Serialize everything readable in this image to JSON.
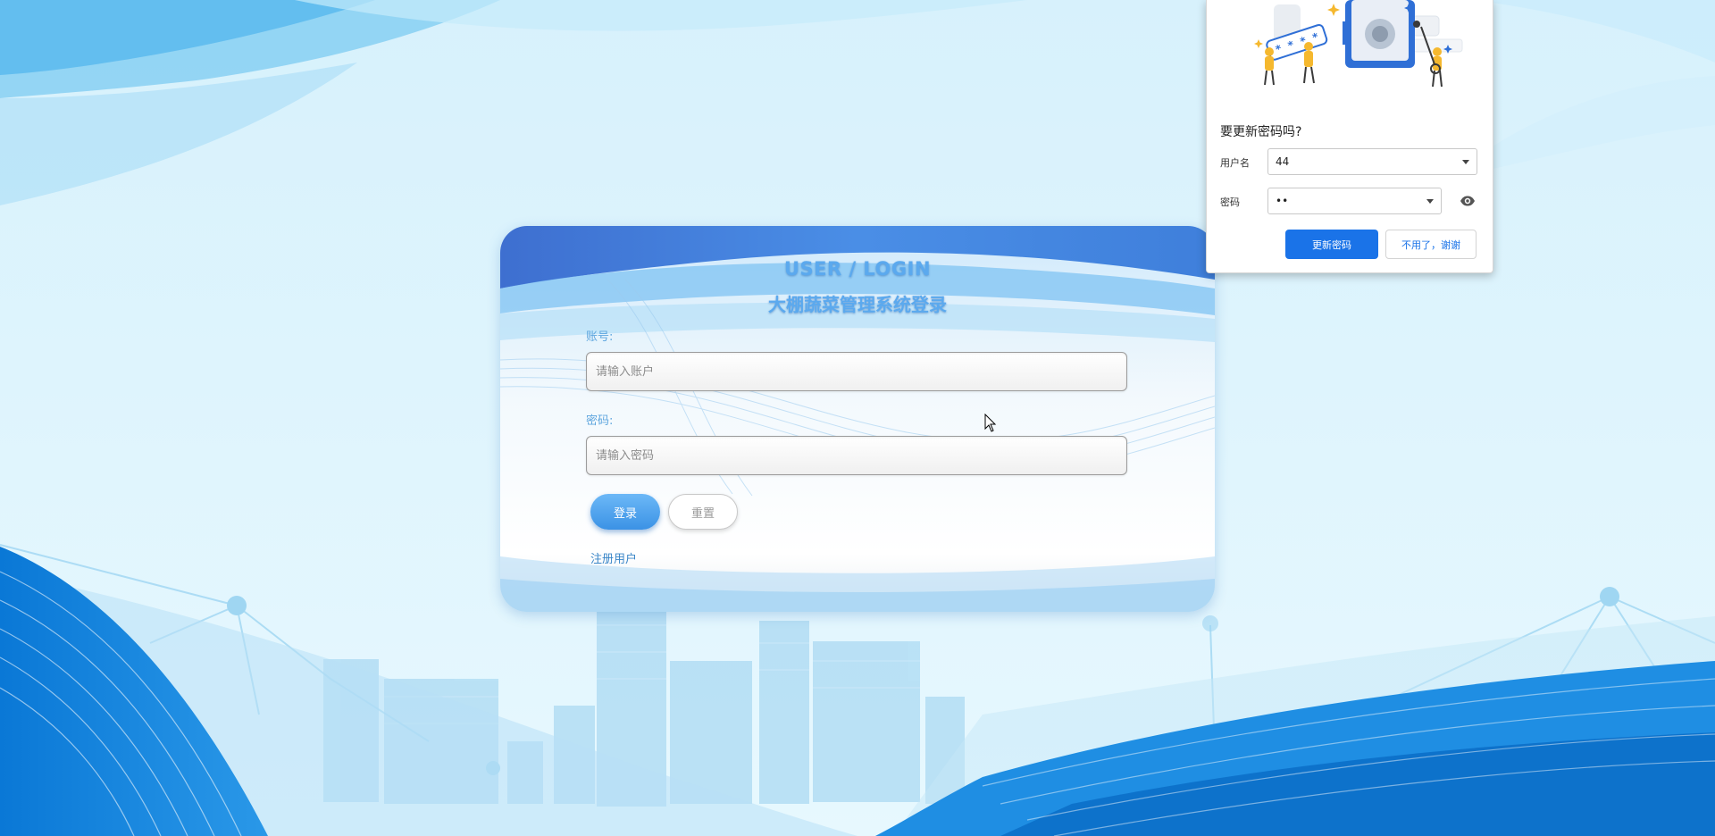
{
  "login": {
    "title_en": "USER / LOGIN",
    "title_cn": "大棚蔬菜管理系统登录",
    "account_label": "账号:",
    "account_placeholder": "请输入账户",
    "password_label": "密码:",
    "password_placeholder": "请输入密码",
    "login_button": "登录",
    "reset_button": "重置",
    "register_link": "注册用户"
  },
  "password_popup": {
    "illustration_mask": "* * * *",
    "title": "要更新密码吗?",
    "username_label": "用户名",
    "username_value": "44",
    "password_label": "密码",
    "password_value": "••",
    "update_button": "更新密码",
    "dismiss_button": "不用了，谢谢"
  },
  "colors": {
    "accent_blue": "#1a73e8",
    "title_blue": "#5ba9ee",
    "label_blue": "#5fa6de",
    "background": "#e3f6fd"
  },
  "icons": {
    "password_visibility": "eye-icon",
    "dropdown": "caret-down-icon",
    "cursor": "mouse-pointer-icon"
  }
}
